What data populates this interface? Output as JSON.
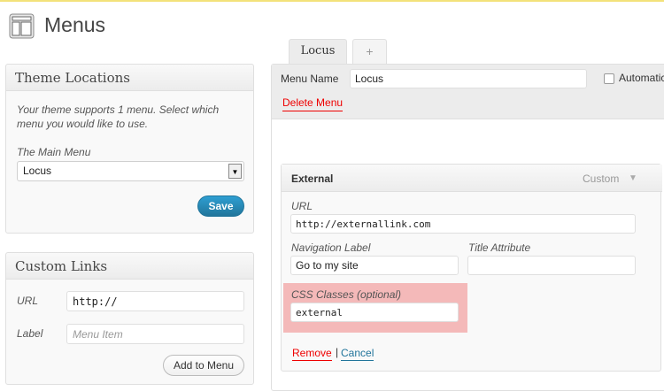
{
  "page": {
    "title": "Menus",
    "icon": "menus-page-icon"
  },
  "theme_locations": {
    "title": "Theme Locations",
    "note": "Your theme supports 1 menu. Select which menu you would like to use.",
    "main_menu_label": "The Main Menu",
    "main_menu_value": "Locus",
    "save_label": "Save"
  },
  "custom_links": {
    "title": "Custom Links",
    "url_label": "URL",
    "url_value": "http://",
    "label_label": "Label",
    "label_placeholder": "Menu Item",
    "add_label": "Add to Menu"
  },
  "tabs": [
    {
      "label": "Locus",
      "active": true
    },
    {
      "label": "+",
      "active": false
    }
  ],
  "menu": {
    "name_label": "Menu Name",
    "name_value": "Locus",
    "auto_label": "Automatic",
    "delete_label": "Delete Menu"
  },
  "item": {
    "title": "External",
    "type": "Custom",
    "arrow": "▼",
    "url_label": "URL",
    "url_value": "http://externallink.com",
    "nav_label": "Navigation Label",
    "nav_value": "Go to my site",
    "title_attr_label": "Title Attribute",
    "title_attr_value": "",
    "css_label": "CSS Classes (optional)",
    "css_value": "external",
    "remove_label": "Remove",
    "separator": "|",
    "cancel_label": "Cancel"
  },
  "colors": {
    "accent": "#21759b",
    "danger": "#e00000",
    "highlight": "#f4b9b9"
  }
}
